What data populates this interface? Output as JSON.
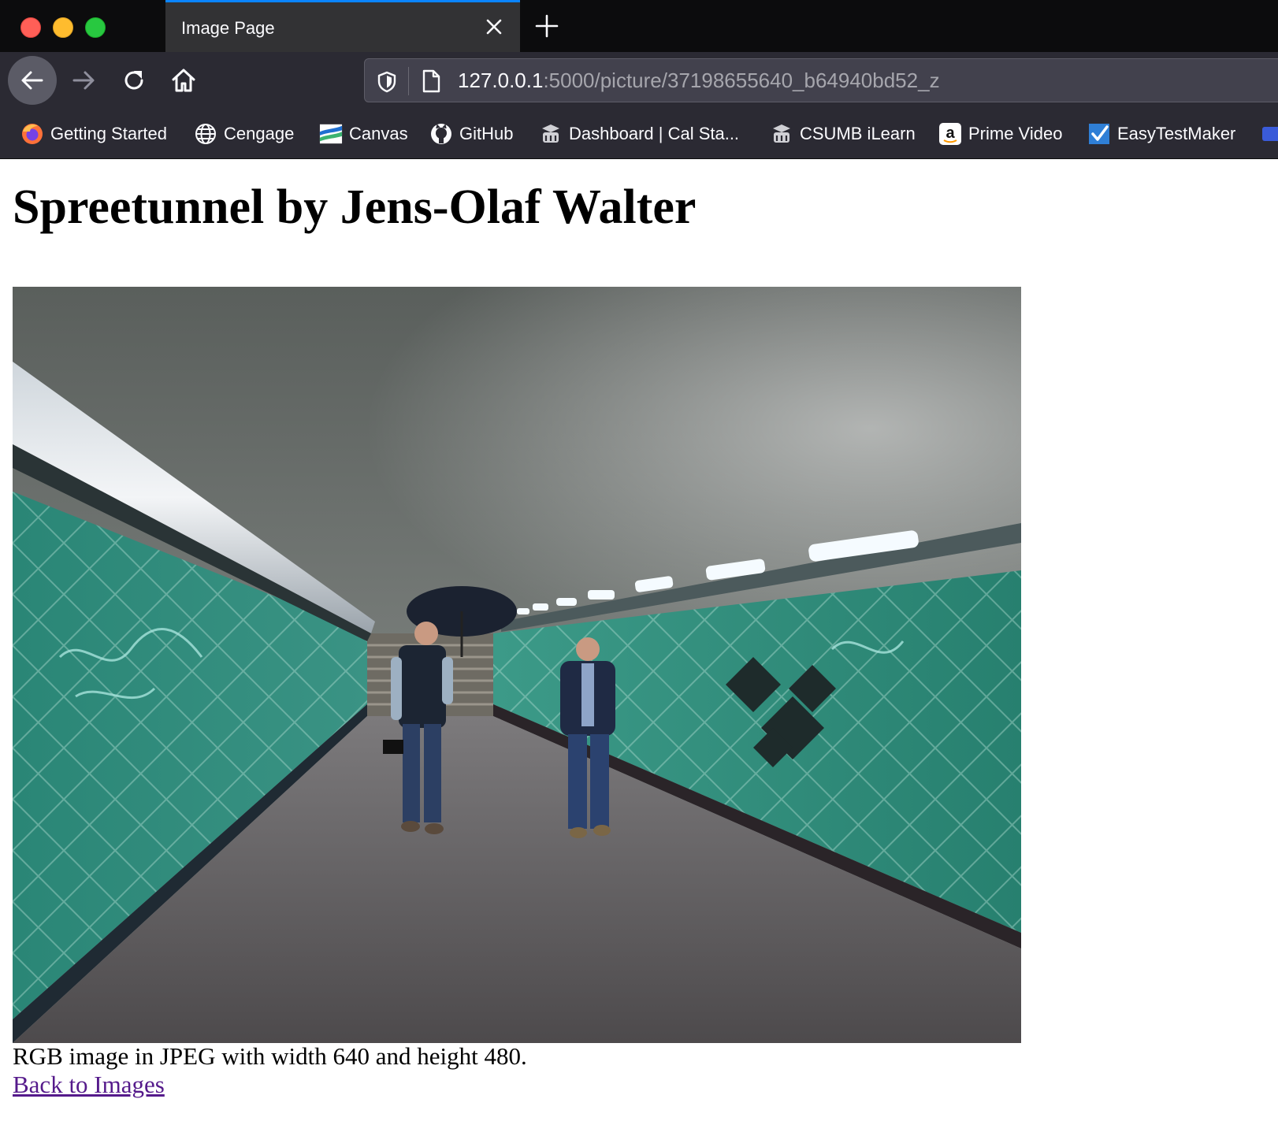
{
  "browser": {
    "tab": {
      "title": "Image Page"
    },
    "url": {
      "host": "127.0.0.1",
      "path": ":5000/picture/37198655640_b64940bd52_z"
    },
    "bookmarks": [
      {
        "label": "Getting Started",
        "icon": "firefox-icon"
      },
      {
        "label": "Cengage",
        "icon": "globe-icon"
      },
      {
        "label": "Canvas",
        "icon": "canvas-icon"
      },
      {
        "label": "GitHub",
        "icon": "github-icon"
      },
      {
        "label": "Dashboard | Cal Sta...",
        "icon": "moodle-icon"
      },
      {
        "label": "CSUMB iLearn",
        "icon": "moodle-icon"
      },
      {
        "label": "Prime Video",
        "icon": "amazon-icon"
      },
      {
        "label": "EasyTestMaker",
        "icon": "checkmark-icon"
      }
    ]
  },
  "page": {
    "heading": "Spreetunnel by Jens-Olaf Walter",
    "caption": "RGB image in JPEG with width 640 and height 480.",
    "back_link": "Back to Images"
  },
  "colors": {
    "tabstrip": "#0c0c0d",
    "toolbar": "#2b2a33",
    "tab_accent": "#0a84ff",
    "tile_green": "#2f8f7c",
    "visited_link": "#551a8b"
  }
}
